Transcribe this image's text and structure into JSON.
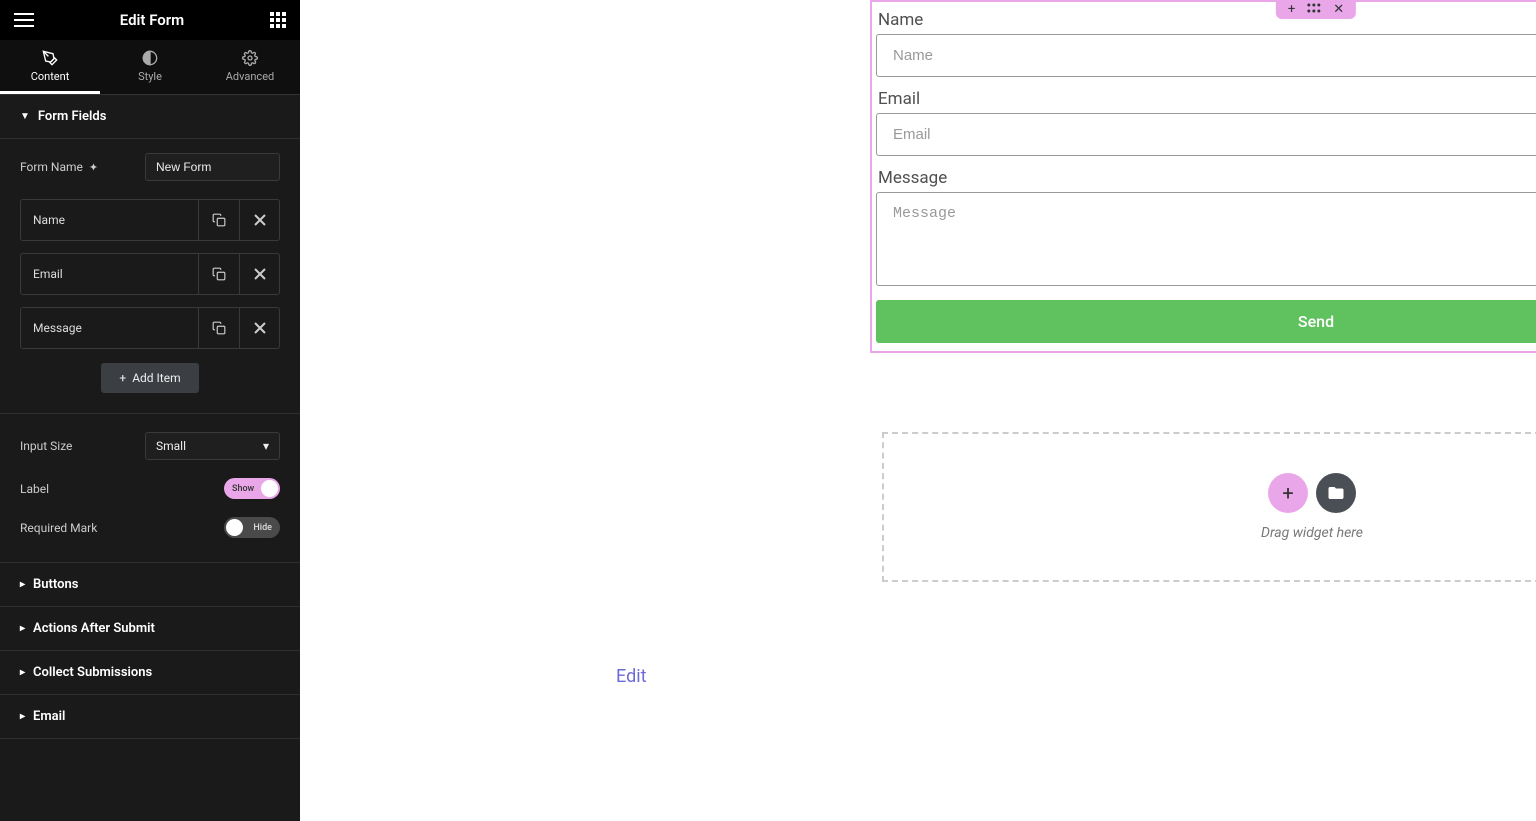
{
  "header": {
    "title": "Edit Form"
  },
  "tabs": {
    "content": "Content",
    "style": "Style",
    "advanced": "Advanced"
  },
  "sections": {
    "form_fields": "Form Fields",
    "buttons": "Buttons",
    "actions": "Actions After Submit",
    "collect": "Collect Submissions",
    "email": "Email"
  },
  "form_name": {
    "label": "Form Name",
    "value": "New Form"
  },
  "fields": [
    {
      "label": "Name"
    },
    {
      "label": "Email"
    },
    {
      "label": "Message"
    }
  ],
  "add_item": "Add Item",
  "input_size": {
    "label": "Input Size",
    "value": "Small"
  },
  "label_toggle": {
    "label": "Label",
    "state": "Show"
  },
  "required_mark": {
    "label": "Required Mark",
    "state": "Hide"
  },
  "preview": {
    "name_label": "Name",
    "name_placeholder": "Name",
    "email_label": "Email",
    "email_placeholder": "Email",
    "message_label": "Message",
    "message_placeholder": "Message",
    "send": "Send"
  },
  "dropzone": {
    "text": "Drag widget here"
  },
  "edit_link": "Edit"
}
